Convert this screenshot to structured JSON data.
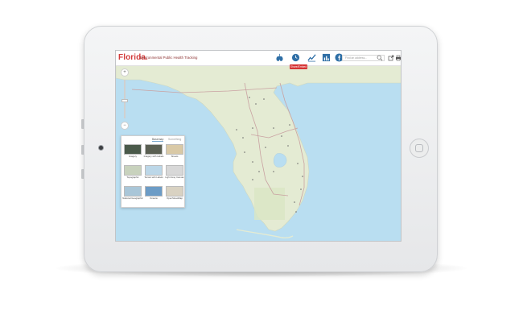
{
  "app": {
    "logo": "Florida.",
    "subtitle": "Environmental Public Health Tracking",
    "accent_color": "#d23a3a"
  },
  "toolbar": {
    "icons": [
      "lungs-icon",
      "clock-icon",
      "chart-line-icon",
      "chart-bar-icon",
      "facebook-icon"
    ],
    "share_label": "Share/Embed",
    "search_placeholder": "Find an address...",
    "actions": [
      "export-icon",
      "print-icon"
    ]
  },
  "map": {
    "zoom_in": "+",
    "zoom_out": "−",
    "water_color": "#b9def1",
    "land_color": "#e6ecd8"
  },
  "basemap_panel": {
    "tabs": [
      "Basemap",
      "Something"
    ],
    "items": [
      {
        "label": "Imagery",
        "swatch": "#4a5a4a"
      },
      {
        "label": "Imagery with Labels",
        "swatch": "#5a5f52"
      },
      {
        "label": "Streets",
        "swatch": "#d9c9a6"
      },
      {
        "label": "Topographic",
        "swatch": "#c8d2bd"
      },
      {
        "label": "Terrain with Labels",
        "swatch": "#bcd7e8"
      },
      {
        "label": "Light Gray Canvas",
        "swatch": "#d8d8d8"
      },
      {
        "label": "National Geographic",
        "swatch": "#a9c6d8"
      },
      {
        "label": "Oceans",
        "swatch": "#6c9cc6"
      },
      {
        "label": "OpenStreetMap",
        "swatch": "#d9d2c2"
      }
    ]
  }
}
